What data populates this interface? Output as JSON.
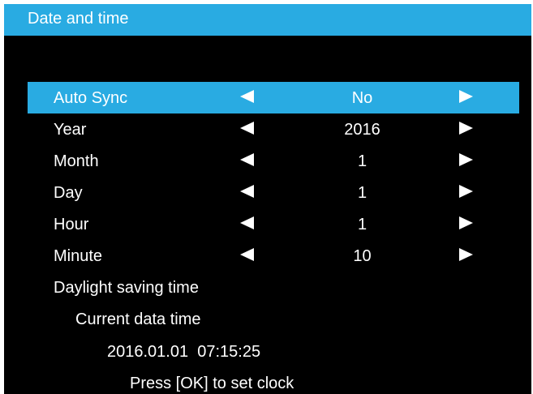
{
  "window": {
    "title": "Date and time"
  },
  "menu": {
    "rows": [
      {
        "label": "Auto Sync",
        "value": "No",
        "selected": true
      },
      {
        "label": "Year",
        "value": "2016",
        "selected": false
      },
      {
        "label": "Month",
        "value": "1",
        "selected": false
      },
      {
        "label": "Day",
        "value": "1",
        "selected": false
      },
      {
        "label": "Hour",
        "value": "1",
        "selected": false
      },
      {
        "label": "Minute",
        "value": "10",
        "selected": false
      }
    ],
    "daylight_saving_label": "Daylight saving time"
  },
  "status": {
    "current_label": "Current data time",
    "current_datetime": "2016.01.01  07:15:25",
    "hint": "Press [OK] to set clock"
  },
  "icons": {
    "decrease": "left-triangle-icon",
    "increase": "right-triangle-icon"
  },
  "colors": {
    "accent": "#29abe2",
    "background": "#000000",
    "text": "#ffffff"
  }
}
